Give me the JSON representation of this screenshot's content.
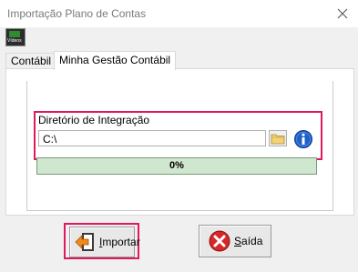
{
  "window": {
    "title": "Importação Plano de Contas"
  },
  "toolbar": {
    "video_label": "Vídeos"
  },
  "tabs": [
    {
      "label": "Contábil",
      "active": false
    },
    {
      "label": "Minha Gestão Contábil",
      "active": true
    }
  ],
  "integration": {
    "label": "Diretório de Integração",
    "path": "C:\\"
  },
  "progress": {
    "value": 0,
    "text": "0%"
  },
  "buttons": {
    "import_first": "I",
    "import_rest": "mportar",
    "exit_first": "S",
    "exit_rest": "aída"
  },
  "colors": {
    "highlight": "#e0195c",
    "progress_bg": "#cfe6cf"
  },
  "icons": [
    "close-icon",
    "video-icon",
    "folder-icon",
    "info-icon",
    "import-arrow-icon",
    "exit-x-icon"
  ]
}
